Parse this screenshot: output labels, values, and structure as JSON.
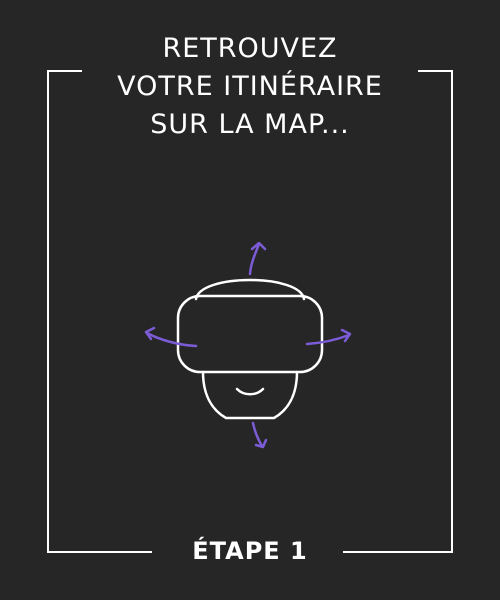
{
  "instruction": {
    "lines": [
      "RETROUVEZ",
      "VOTRE ITINÉRAIRE",
      "SUR LA MAP..."
    ]
  },
  "step": {
    "label": "ÉTAPE 1"
  },
  "illustration": {
    "icon": "vr-headset-icon",
    "arrows": [
      "arrow-up-icon",
      "arrow-left-icon",
      "arrow-right-icon",
      "arrow-down-icon"
    ]
  },
  "colors": {
    "background": "#262626",
    "line": "#ffffff",
    "accent": "#7b5cd6"
  }
}
